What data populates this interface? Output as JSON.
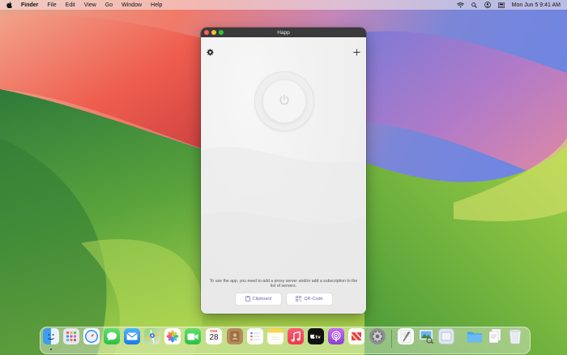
{
  "menubar": {
    "app_name": "Finder",
    "menus": [
      "File",
      "Edit",
      "View",
      "Go",
      "Window",
      "Help"
    ],
    "clock": "Mon Jun 5  9:41 AM"
  },
  "window": {
    "title": "Happ",
    "hint": "To use the app, you need to add a proxy server and/or add a subscription to the list of servers.",
    "clipboard_label": "Clipboard",
    "qrcode_label": "QR-Code"
  },
  "dock": {
    "calendar_month": "FEB",
    "calendar_day": "28",
    "apps": [
      "Finder",
      "Launchpad",
      "Safari",
      "Messages",
      "Mail",
      "Maps",
      "Photos",
      "FaceTime",
      "Calendar",
      "Contacts",
      "Reminders",
      "Notes",
      "Music",
      "TV",
      "Podcasts",
      "News",
      "System Settings",
      "TextEdit",
      "Preview",
      "Screen Sharing",
      "Folder",
      "Documents",
      "Trash"
    ]
  },
  "colors": {
    "window_accent": "#6a6aa8",
    "close": "#ff5f57",
    "minimize": "#febc2e",
    "zoom": "#28c840"
  }
}
